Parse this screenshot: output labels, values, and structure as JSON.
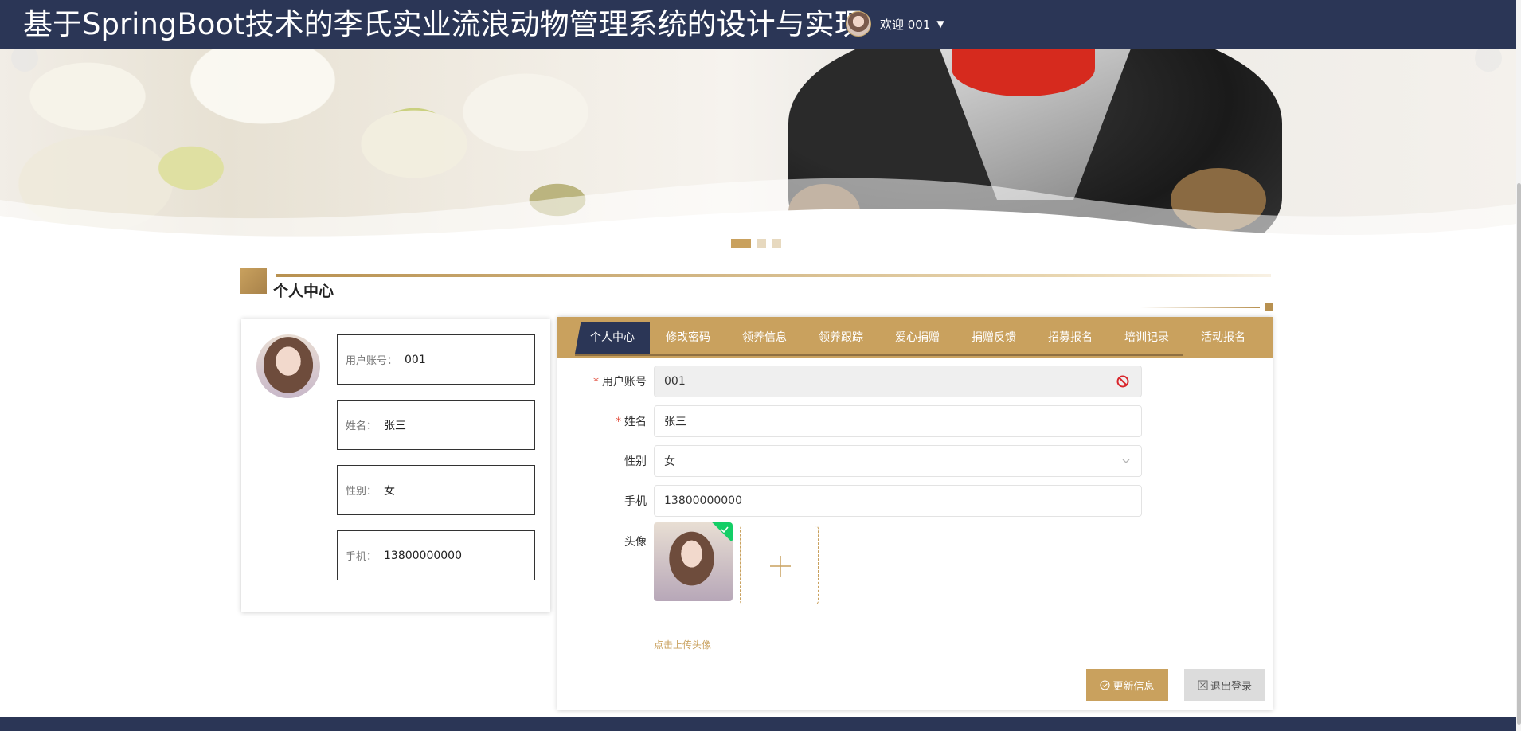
{
  "header": {
    "site_title": "基于SpringBoot技术的李氏实业流浪动物管理系统的设计与实现",
    "welcome_text": "欢迎 001",
    "caret": "▼"
  },
  "carousel": {
    "slide_count": 3,
    "active_index": 0
  },
  "section": {
    "title": "个人中心"
  },
  "profile_card": {
    "fields": [
      {
        "label": "用户账号：",
        "value": "001"
      },
      {
        "label": "姓名：",
        "value": "张三"
      },
      {
        "label": "性别：",
        "value": "女"
      },
      {
        "label": "手机：",
        "value": "13800000000"
      }
    ]
  },
  "tabs": [
    {
      "label": "个人中心",
      "active": true
    },
    {
      "label": "修改密码",
      "active": false
    },
    {
      "label": "领养信息",
      "active": false
    },
    {
      "label": "领养跟踪",
      "active": false
    },
    {
      "label": "爱心捐赠",
      "active": false
    },
    {
      "label": "捐赠反馈",
      "active": false
    },
    {
      "label": "招募报名",
      "active": false
    },
    {
      "label": "培训记录",
      "active": false
    },
    {
      "label": "活动报名",
      "active": false
    }
  ],
  "form": {
    "required_mark": "*",
    "account": {
      "label": "用户账号",
      "value": "001",
      "required": true,
      "disabled": true
    },
    "name": {
      "label": "姓名",
      "value": "张三",
      "required": true
    },
    "gender": {
      "label": "性别",
      "value": "女"
    },
    "phone": {
      "label": "手机",
      "value": "13800000000"
    },
    "avatar": {
      "label": "头像",
      "hint": "点击上传头像"
    }
  },
  "actions": {
    "update_label": "更新信息",
    "logout_label": "退出登录"
  },
  "colors": {
    "header_bg": "#2b3656",
    "accent_gold": "#c9a15e",
    "success_green": "#13ce66",
    "danger_red": "#e24b3a"
  },
  "icons": {
    "disabled": "ban-icon",
    "select": "chevron-down-icon",
    "upload": "plus-icon",
    "uploaded": "check-icon",
    "update": "check-circle-icon",
    "logout": "close-square-icon"
  }
}
